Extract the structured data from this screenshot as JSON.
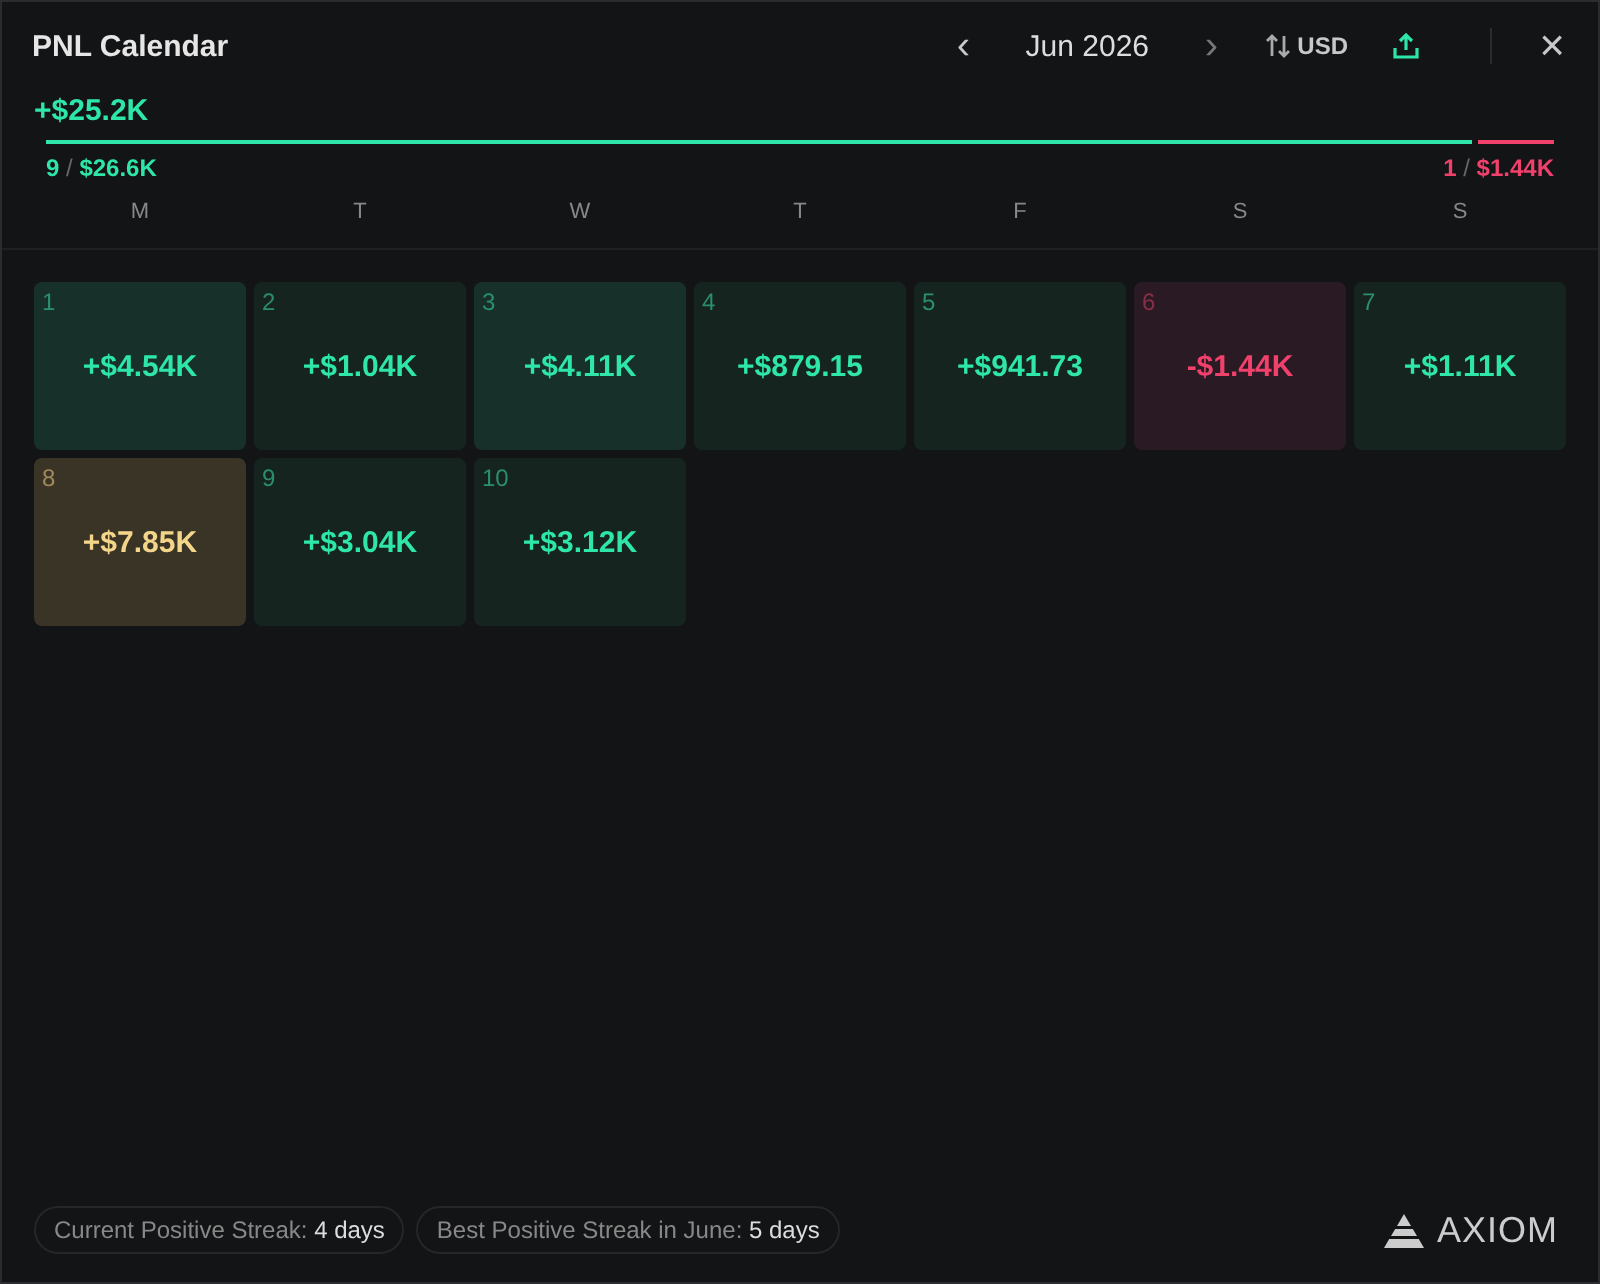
{
  "header": {
    "title": "PNL Calendar",
    "prev": "‹",
    "month": "Jun 2026",
    "next": "›",
    "currency": "USD",
    "close": "×"
  },
  "summary": {
    "total": "+$25.2K",
    "separator": "/",
    "wins": {
      "count": "9",
      "amount": "$26.6K",
      "level": 0.95
    },
    "losses": {
      "count": "1",
      "amount": "$1.44K"
    }
  },
  "weekdays": [
    "M",
    "T",
    "W",
    "T",
    "F",
    "S",
    "S"
  ],
  "days": [
    {
      "day": "1",
      "pnl": "+$4.54K",
      "kind": "gain-strong"
    },
    {
      "day": "2",
      "pnl": "+$1.04K",
      "kind": "gain"
    },
    {
      "day": "3",
      "pnl": "+$4.11K",
      "kind": "gain-strong"
    },
    {
      "day": "4",
      "pnl": "+$879.15",
      "kind": "gain"
    },
    {
      "day": "5",
      "pnl": "+$941.73",
      "kind": "gain"
    },
    {
      "day": "6",
      "pnl": "-$1.44K",
      "kind": "loss"
    },
    {
      "day": "7",
      "pnl": "+$1.11K",
      "kind": "gain"
    },
    {
      "day": "8",
      "pnl": "+$7.85K",
      "kind": "best"
    },
    {
      "day": "9",
      "pnl": "+$3.04K",
      "kind": "gain"
    },
    {
      "day": "10",
      "pnl": "+$3.12K",
      "kind": "gain"
    }
  ],
  "streaks": [
    "Current Positive Streak: **4 days**",
    "Best Positive Streak in June: **5 days**"
  ],
  "brand": "AXIOM"
}
